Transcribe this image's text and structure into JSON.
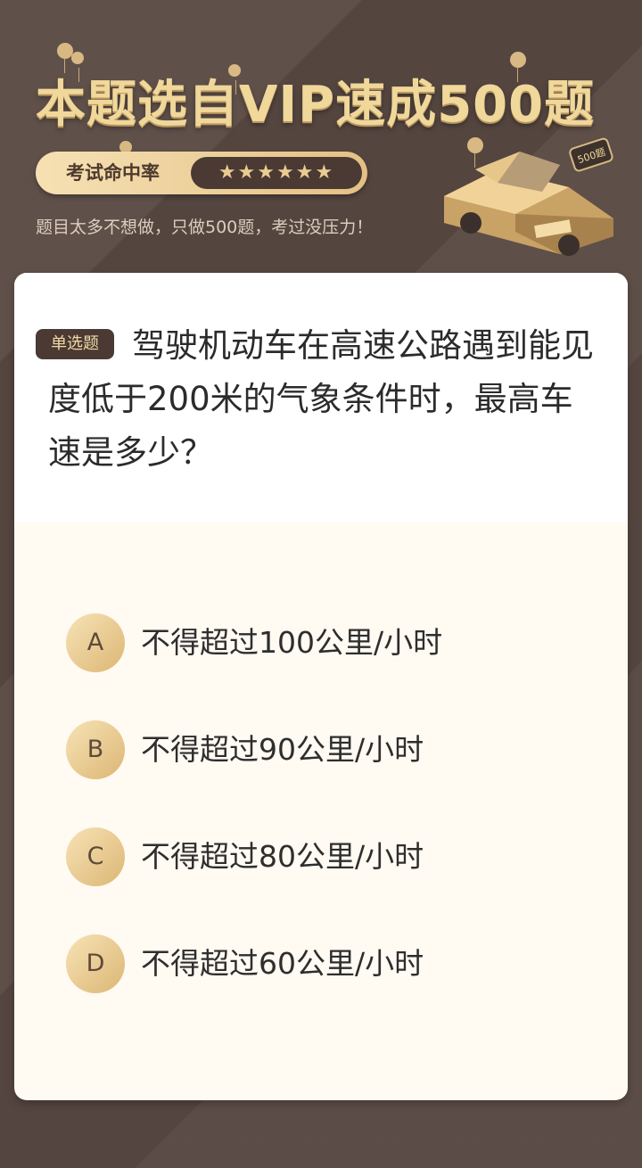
{
  "header": {
    "title": "本题选自VIP速成500题",
    "rate_label": "考试命中率",
    "rate_stars": "★★★★★★",
    "subtitle": "题目太多不想做，只做500题，考过没压力！",
    "car_badge": "500题"
  },
  "question": {
    "type_badge": "单选题",
    "text": "驾驶机动车在高速公路遇到能见度低于200米的气象条件时，最高车速是多少？"
  },
  "options": [
    {
      "letter": "A",
      "text": "不得超过100公里/小时"
    },
    {
      "letter": "B",
      "text": "不得超过90公里/小时"
    },
    {
      "letter": "C",
      "text": "不得超过80公里/小时"
    },
    {
      "letter": "D",
      "text": "不得超过60公里/小时"
    }
  ],
  "colors": {
    "background": "#594943",
    "gold": "#f0d79a",
    "badge_dark": "#4a3a33",
    "card": "#fffaf2"
  }
}
